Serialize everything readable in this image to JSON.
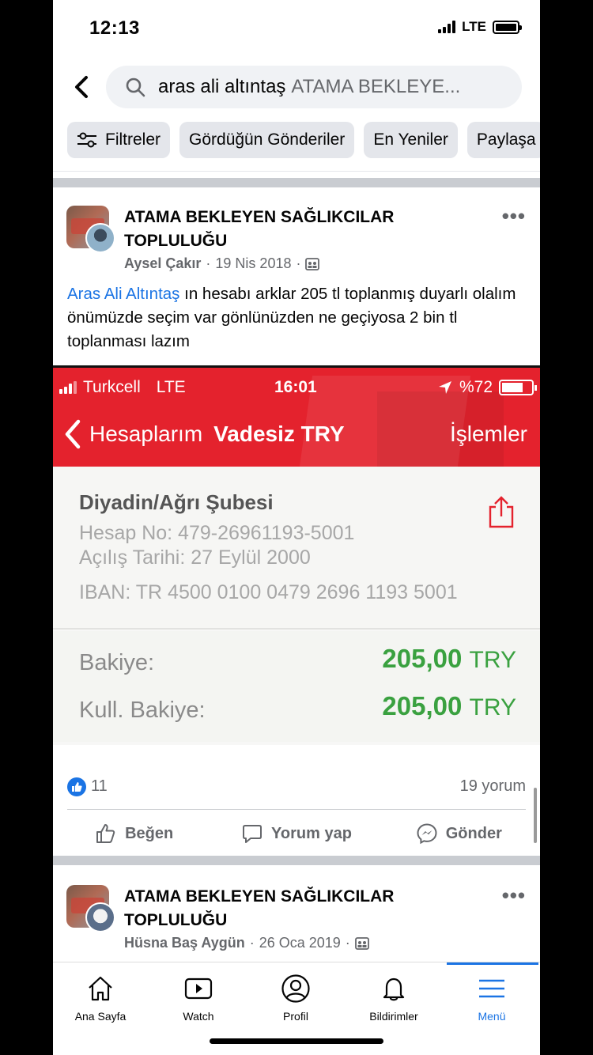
{
  "status_bar": {
    "time": "12:13",
    "network": "LTE"
  },
  "search": {
    "query": "aras ali altıntaş",
    "scope_hint": "ATAMA BEKLEYE..."
  },
  "filters": [
    {
      "label": "Filtreler",
      "icon": "sliders-icon"
    },
    {
      "label": "Gördüğün Gönderiler"
    },
    {
      "label": "En Yeniler"
    },
    {
      "label": "Paylaşa"
    }
  ],
  "post1": {
    "group_name": "ATAMA BEKLEYEN SAĞLIKCILAR TOPLULUĞU",
    "author": "Aysel Çakır",
    "date": "19 Nis 2018",
    "separator": "·",
    "mention": "Aras Ali Altıntaş",
    "text": " ın hesabı arklar 205 tl toplanmış duyarlı olalım önümüzde seçim var gönlünüzden ne geçiyosa 2 bin tl toplanması lazım",
    "reactions_count": "11",
    "comments_count": "19 yorum",
    "actions": {
      "like": "Beğen",
      "comment": "Yorum yap",
      "send": "Gönder"
    }
  },
  "embedded_screenshot": {
    "carrier": "Turkcell",
    "network": "LTE",
    "time": "16:01",
    "battery": "%72",
    "battery_level": 0.72,
    "back_label": "Hesaplarım",
    "title": "Vadesiz TRY",
    "right_action": "İşlemler",
    "branch": "Diyadin/Ağrı Şubesi",
    "account_no": "Hesap No: 479-26961193-5001",
    "opened": "Açılış Tarihi: 27 Eylül 2000",
    "iban": "IBAN: TR 4500 0100 0479 2696 1193 5001",
    "balance_label": "Bakiye:",
    "balance_value": "205,00",
    "available_label": "Kull. Bakiye:",
    "available_value": "205,00",
    "currency": "TRY"
  },
  "post2": {
    "group_name": "ATAMA BEKLEYEN SAĞLIKCILAR TOPLULUĞU",
    "author": "Hüsna Baş Aygün",
    "date": "26 Oca 2019",
    "separator": "·"
  },
  "tabbar": [
    {
      "label": "Ana Sayfa",
      "icon": "home-icon"
    },
    {
      "label": "Watch",
      "icon": "watch-icon"
    },
    {
      "label": "Profil",
      "icon": "profile-icon"
    },
    {
      "label": "Bildirimler",
      "icon": "bell-icon"
    },
    {
      "label": "Menü",
      "icon": "menu-icon",
      "active": true
    }
  ],
  "colors": {
    "accent": "#1b74e4",
    "bank_red": "#e4222d",
    "balance_green": "#3aa140"
  }
}
